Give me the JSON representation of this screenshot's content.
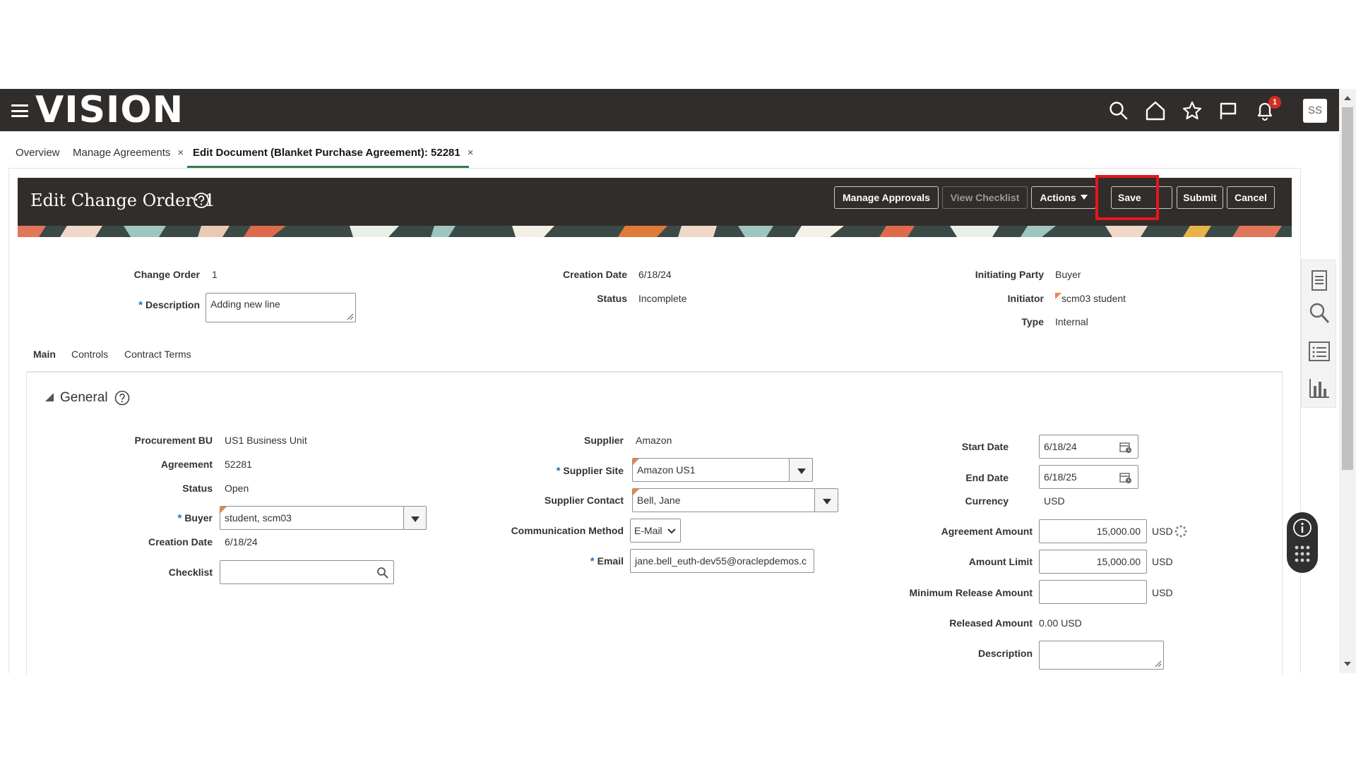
{
  "header": {
    "logo_text": "VISION",
    "notification_count": "1",
    "avatar_initials": "SS",
    "icons": [
      "menu-icon",
      "search-icon",
      "home-icon",
      "star-icon",
      "flag-icon",
      "bell-icon"
    ]
  },
  "tabs": [
    {
      "label": "Overview",
      "closable": false
    },
    {
      "label": "Manage Agreements",
      "closable": true
    },
    {
      "label": "Edit Document (Blanket Purchase Agreement): 52281",
      "closable": true,
      "active": true
    }
  ],
  "tab_close_glyph": "×",
  "page": {
    "title": "Edit Change Order: 1",
    "buttons": {
      "manage_approvals": "Manage Approvals",
      "view_checklist": "View Checklist",
      "actions": "Actions",
      "save": "Save",
      "submit": "Submit",
      "cancel": "Cancel"
    }
  },
  "summary": {
    "change_order_label": "Change Order",
    "change_order_value": "1",
    "description_label": "Description",
    "description_value": "Adding new line",
    "creation_date_label": "Creation Date",
    "creation_date_value": "6/18/24",
    "status_label": "Status",
    "status_value": "Incomplete",
    "initiating_party_label": "Initiating Party",
    "initiating_party_value": "Buyer",
    "initiator_label": "Initiator",
    "initiator_value": "scm03 student",
    "type_label": "Type",
    "type_value": "Internal"
  },
  "subtabs": [
    "Main",
    "Controls",
    "Contract Terms"
  ],
  "general": {
    "section_title": "General",
    "procurement_bu_label": "Procurement BU",
    "procurement_bu_value": "US1 Business Unit",
    "agreement_label": "Agreement",
    "agreement_value": "52281",
    "status_label": "Status",
    "status_value": "Open",
    "buyer_label": "Buyer",
    "buyer_value": "student, scm03",
    "creation_date_label": "Creation Date",
    "creation_date_value": "6/18/24",
    "checklist_label": "Checklist",
    "checklist_value": "",
    "supplier_label": "Supplier",
    "supplier_value": "Amazon",
    "supplier_site_label": "Supplier Site",
    "supplier_site_value": "Amazon US1",
    "supplier_contact_label": "Supplier Contact",
    "supplier_contact_value": "Bell, Jane",
    "communication_method_label": "Communication Method",
    "communication_method_value": "E-Mail",
    "email_label": "Email",
    "email_value": "jane.bell_euth-dev55@oraclepdemos.c",
    "start_date_label": "Start Date",
    "start_date_value": "6/18/24",
    "end_date_label": "End Date",
    "end_date_value": "6/18/25",
    "currency_label": "Currency",
    "currency_value": "USD",
    "agreement_amount_label": "Agreement Amount",
    "agreement_amount_value": "15,000.00",
    "amount_limit_label": "Amount Limit",
    "amount_limit_value": "15,000.00",
    "min_release_label": "Minimum Release Amount",
    "min_release_value": "",
    "released_amount_label": "Released Amount",
    "released_amount_value": "0.00",
    "description_label": "Description",
    "description_value": "",
    "currency_unit": "USD"
  },
  "colors": {
    "header_bg": "#312d2a",
    "active_tab_underline": "#3c7a4a",
    "highlight": "#e5161d",
    "required_star": "#1a6ec5"
  }
}
